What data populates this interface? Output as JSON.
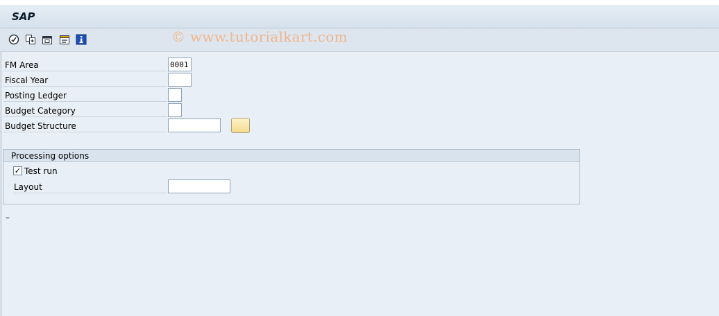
{
  "window": {
    "title": "SAP"
  },
  "watermark": "© www.tutorialkart.com",
  "toolbar": {
    "buttons": [
      {
        "name": "execute-icon"
      },
      {
        "name": "get-variant-icon"
      },
      {
        "name": "save-variant-icon"
      },
      {
        "name": "selection-options-icon"
      },
      {
        "name": "info-icon"
      }
    ]
  },
  "form": {
    "fm_area": {
      "label": "FM Area",
      "value": "0001"
    },
    "fiscal_year": {
      "label": "Fiscal Year",
      "value": ""
    },
    "posting_ledger": {
      "label": "Posting Ledger",
      "value": ""
    },
    "budget_category": {
      "label": "Budget Category",
      "value": ""
    },
    "budget_structure": {
      "label": "Budget Structure",
      "value": ""
    }
  },
  "processing_options": {
    "title": "Processing options",
    "test_run": {
      "label": "Test run",
      "checked": true,
      "mark": "✓"
    },
    "layout": {
      "label": "Layout",
      "value": ""
    }
  },
  "status": {
    "cursor": "–"
  }
}
